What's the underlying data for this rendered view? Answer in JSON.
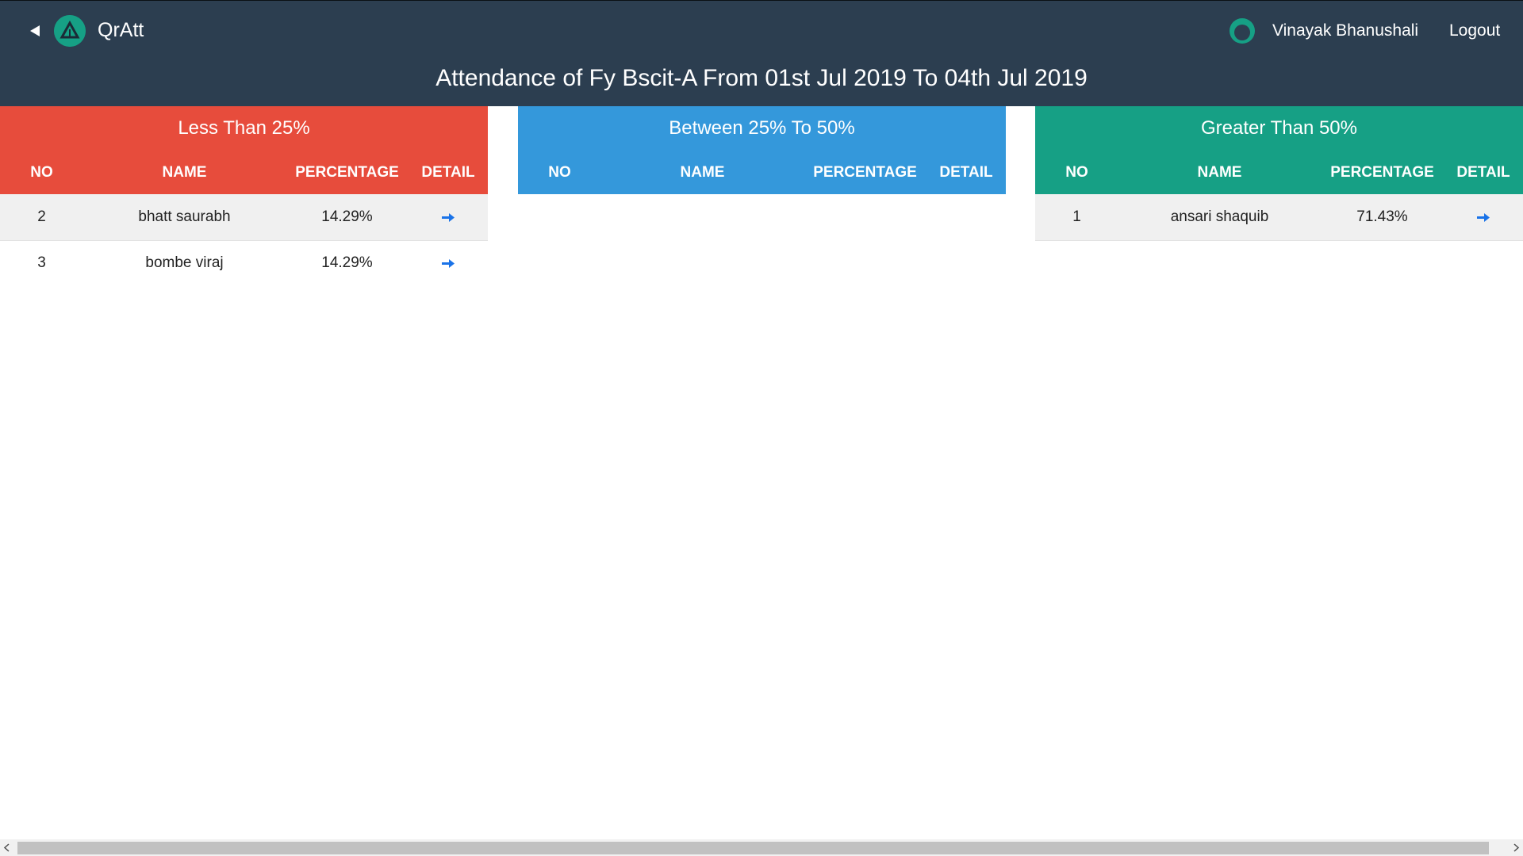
{
  "header": {
    "app_title": "QrAtt",
    "user_name": "Vinayak Bhanushali",
    "logout_label": "Logout",
    "page_title": "Attendance of Fy Bscit-A From 01st Jul 2019 To 04th Jul 2019"
  },
  "columns": {
    "no": "NO",
    "name": "NAME",
    "percentage": "PERCENTAGE",
    "detail": "DETAIL"
  },
  "colors": {
    "header_bg": "#2c3e50",
    "low": "#e74c3c",
    "mid": "#3498db",
    "high": "#16a085",
    "detail_icon": "#1a73e8"
  },
  "icons": {
    "back": "back-arrow-icon",
    "logo": "qratt-logo-icon",
    "avatar": "user-avatar-icon",
    "detail": "detail-arrow-icon"
  },
  "panels": {
    "low": {
      "title": "Less Than 25%",
      "rows": [
        {
          "no": "2",
          "name": "bhatt saurabh",
          "percentage": "14.29%"
        },
        {
          "no": "3",
          "name": "bombe viraj",
          "percentage": "14.29%"
        }
      ]
    },
    "mid": {
      "title": "Between 25% To 50%",
      "rows": []
    },
    "high": {
      "title": "Greater Than 50%",
      "rows": [
        {
          "no": "1",
          "name": "ansari shaquib",
          "percentage": "71.43%"
        }
      ]
    }
  }
}
